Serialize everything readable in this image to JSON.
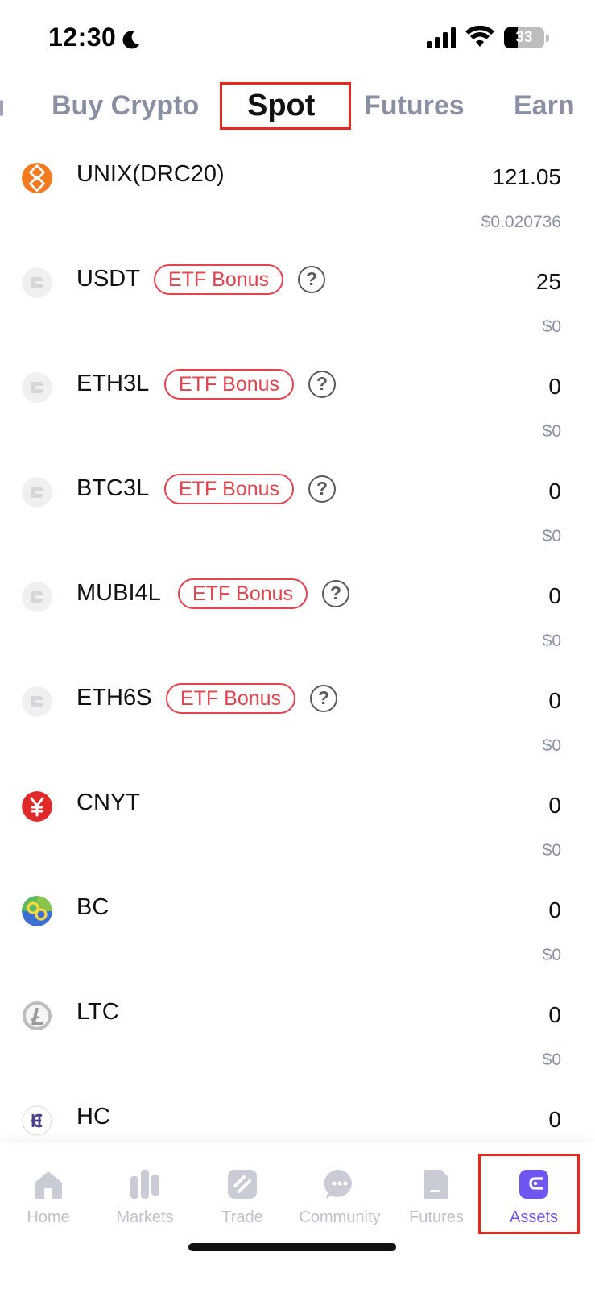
{
  "status_bar": {
    "time": "12:30",
    "battery": "33"
  },
  "tabs": [
    {
      "label": "Buy Crypto",
      "active": false
    },
    {
      "label": "Spot",
      "active": true
    },
    {
      "label": "Futures",
      "active": false
    },
    {
      "label": "Earn",
      "active": false
    }
  ],
  "assets": [
    {
      "name": "UNIX(DRC20)",
      "amount": "121.05",
      "value": "$0.020736",
      "icon": "unix-coin-icon"
    },
    {
      "name": "USDT",
      "badge": "ETF Bonus",
      "help": "?",
      "amount": "25",
      "value": "$0",
      "icon": "placeholder-coin-icon"
    },
    {
      "name": "ETH3L",
      "badge": "ETF Bonus",
      "help": "?",
      "amount": "0",
      "value": "$0",
      "icon": "placeholder-coin-icon"
    },
    {
      "name": "BTC3L",
      "badge": "ETF Bonus",
      "help": "?",
      "amount": "0",
      "value": "$0",
      "icon": "placeholder-coin-icon"
    },
    {
      "name": "MUBI4L",
      "badge": "ETF Bonus",
      "help": "?",
      "amount": "0",
      "value": "$0",
      "icon": "placeholder-coin-icon"
    },
    {
      "name": "ETH6S",
      "badge": "ETF Bonus",
      "help": "?",
      "amount": "0",
      "value": "$0",
      "icon": "placeholder-coin-icon"
    },
    {
      "name": "CNYT",
      "amount": "0",
      "value": "$0",
      "icon": "cnyt-coin-icon"
    },
    {
      "name": "BC",
      "amount": "0",
      "value": "$0",
      "icon": "bc-coin-icon"
    },
    {
      "name": "LTC",
      "amount": "0",
      "value": "$0",
      "icon": "ltc-coin-icon"
    },
    {
      "name": "HC",
      "amount": "0",
      "value": "",
      "icon": "hc-coin-icon"
    }
  ],
  "nav": [
    {
      "label": "Home",
      "icon": "home-icon"
    },
    {
      "label": "Markets",
      "icon": "markets-icon"
    },
    {
      "label": "Trade",
      "icon": "trade-icon"
    },
    {
      "label": "Community",
      "icon": "community-icon"
    },
    {
      "label": "Futures",
      "icon": "futures-icon"
    },
    {
      "label": "Assets",
      "icon": "wallet-icon",
      "active": true
    }
  ],
  "colors": {
    "accent": "#6f55f2",
    "badge": "#e5424d",
    "highlight": "#e8291c",
    "muted": "#8a8fa3"
  }
}
